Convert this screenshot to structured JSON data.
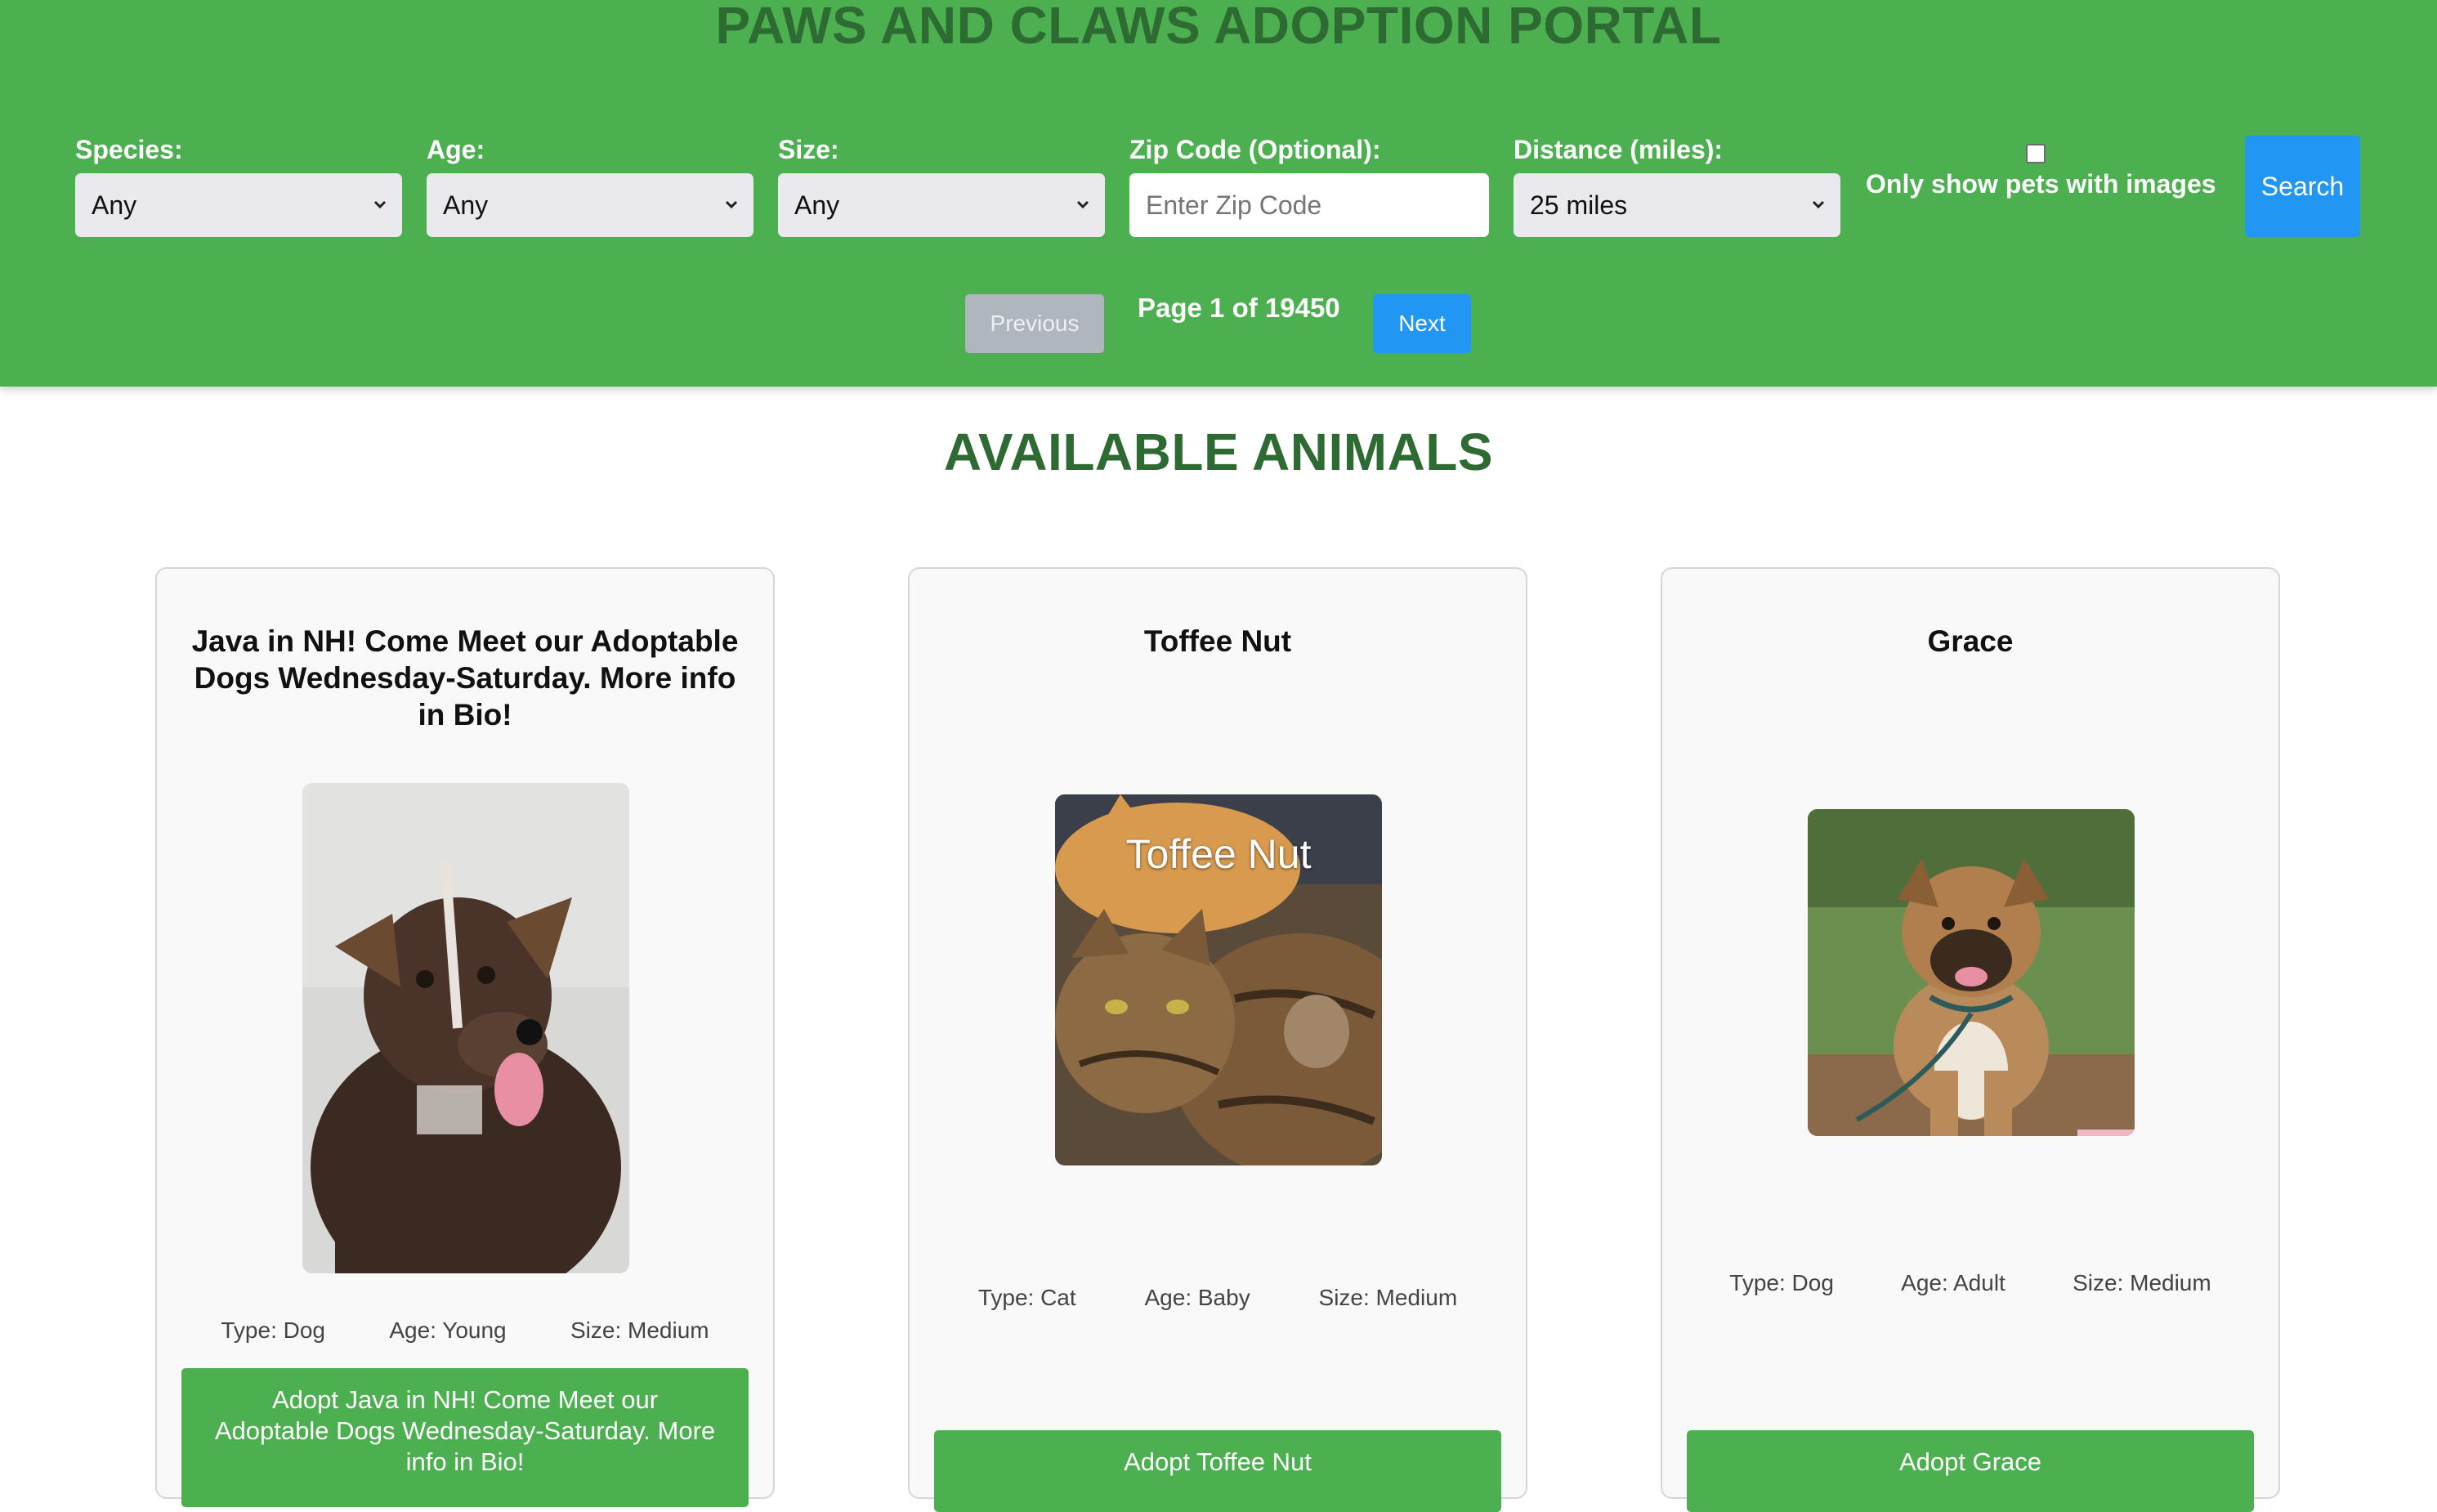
{
  "header": {
    "title": "PAWS AND CLAWS ADOPTION PORTAL",
    "filters": {
      "species": {
        "label": "Species:",
        "value": "Any"
      },
      "age": {
        "label": "Age:",
        "value": "Any"
      },
      "size": {
        "label": "Size:",
        "value": "Any"
      },
      "zip": {
        "label": "Zip Code (Optional):",
        "value": "",
        "placeholder": "Enter Zip Code"
      },
      "distance": {
        "label": "Distance (miles):",
        "value": "25 miles"
      },
      "images_only": {
        "label": "Only show pets with images",
        "checked": false
      },
      "search_label": "Search"
    },
    "pagination": {
      "previous_label": "Previous",
      "page_info": "Page 1 of 19450",
      "next_label": "Next"
    }
  },
  "main": {
    "section_title": "AVAILABLE ANIMALS",
    "animals": [
      {
        "name": "Java in NH! Come Meet our Adoptable Dogs Wednesday-Saturday. More info in Bio!",
        "type": "Type: Dog",
        "age": "Age: Young",
        "size": "Size: Medium",
        "adopt_label": "Adopt Java in NH! Come Meet our Adoptable Dogs Wednesday-Saturday. More info in Bio!",
        "photo_icon": "brown-dog-photo"
      },
      {
        "name": "Toffee Nut",
        "photo_caption": "Toffee Nut",
        "type": "Type: Cat",
        "age": "Age: Baby",
        "size": "Size: Medium",
        "adopt_label": "Adopt Toffee Nut",
        "photo_icon": "tabby-cats-photo"
      },
      {
        "name": "Grace",
        "type": "Type: Dog",
        "age": "Age: Adult",
        "size": "Size: Medium",
        "adopt_label": "Adopt Grace",
        "photo_icon": "tan-dog-photo"
      }
    ]
  },
  "colors": {
    "header_bg": "#4caf50",
    "title_green": "#2e6b32",
    "primary_blue": "#2196f3",
    "disabled_gray": "#b0b6bd"
  }
}
